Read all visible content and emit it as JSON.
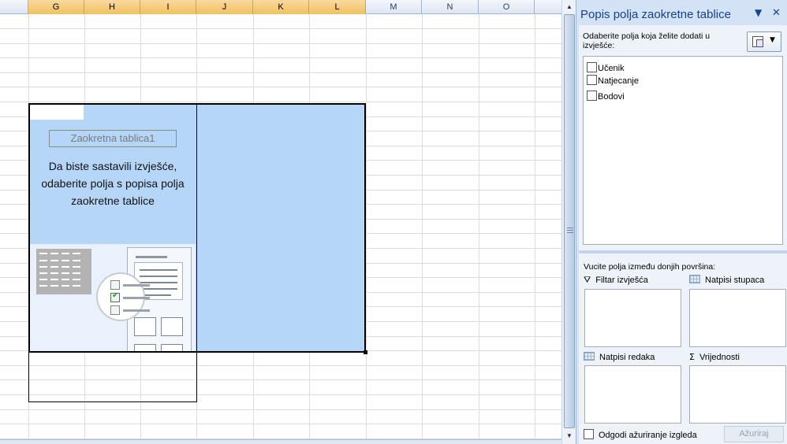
{
  "columns": [
    {
      "letter": "G",
      "selected": true
    },
    {
      "letter": "H",
      "selected": true
    },
    {
      "letter": "I",
      "selected": true
    },
    {
      "letter": "J",
      "selected": true
    },
    {
      "letter": "K",
      "selected": true
    },
    {
      "letter": "L",
      "selected": true
    },
    {
      "letter": "M",
      "selected": false
    },
    {
      "letter": "N",
      "selected": false
    },
    {
      "letter": "O",
      "selected": false
    }
  ],
  "pivot_placeholder": {
    "title": "Zaokretna tablica1",
    "instructions": "Da biste sastavili izvješće, odaberite polja s popisa polja zaokretne tablice"
  },
  "panel": {
    "title": "Popis polja zaokretne tablice",
    "choose_label": "Odaberite polja koja želite dodati u izvješće:",
    "fields": [
      {
        "label": "Učenik",
        "checked": false
      },
      {
        "label": "Natjecanje",
        "checked": false
      },
      {
        "label": "Bodovi",
        "checked": false
      }
    ],
    "drag_label": "Vucite polja između donjih površina:",
    "areas": {
      "report_filter": "Filtar izvješća",
      "column_labels": "Natpisi stupaca",
      "row_labels": "Natpisi redaka",
      "values": "Vrijednosti"
    },
    "defer_label": "Odgodi ažuriranje izgleda",
    "update_button": "Ažuriraj"
  },
  "icons": {
    "menu": "dropdown-triangle-icon",
    "close": "close-icon",
    "layout": "field-list-layout-icon",
    "filter": "funnel-icon",
    "columns": "table-grid-icon",
    "rows": "table-grid-icon",
    "values": "sigma-icon"
  },
  "colors": {
    "selection_fill": "#b6d6f8",
    "selected_header": "#f1c15f",
    "panel_background": "#d3e2f4",
    "panel_title": "#15428b"
  }
}
